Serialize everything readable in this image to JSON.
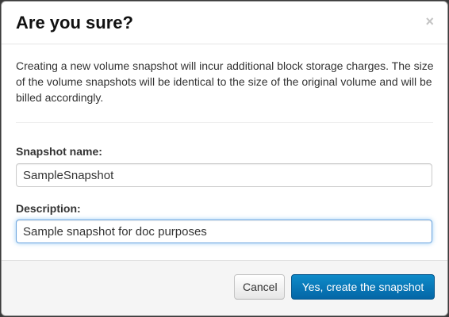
{
  "dialog": {
    "title": "Are you sure?",
    "close_symbol": "×",
    "message": "Creating a new volume snapshot will incur additional block storage charges. The size of the volume snapshots will be identical to the size of the original volume and will be billed accordingly."
  },
  "form": {
    "snapshot_name_label": "Snapshot name:",
    "snapshot_name_value": "SampleSnapshot",
    "description_label": "Description:",
    "description_value": "Sample snapshot for doc purposes"
  },
  "footer": {
    "cancel_label": "Cancel",
    "confirm_label": "Yes, create the snapshot"
  },
  "colors": {
    "primary_button": "#0466a6",
    "focus_ring": "#6ea6e0"
  }
}
